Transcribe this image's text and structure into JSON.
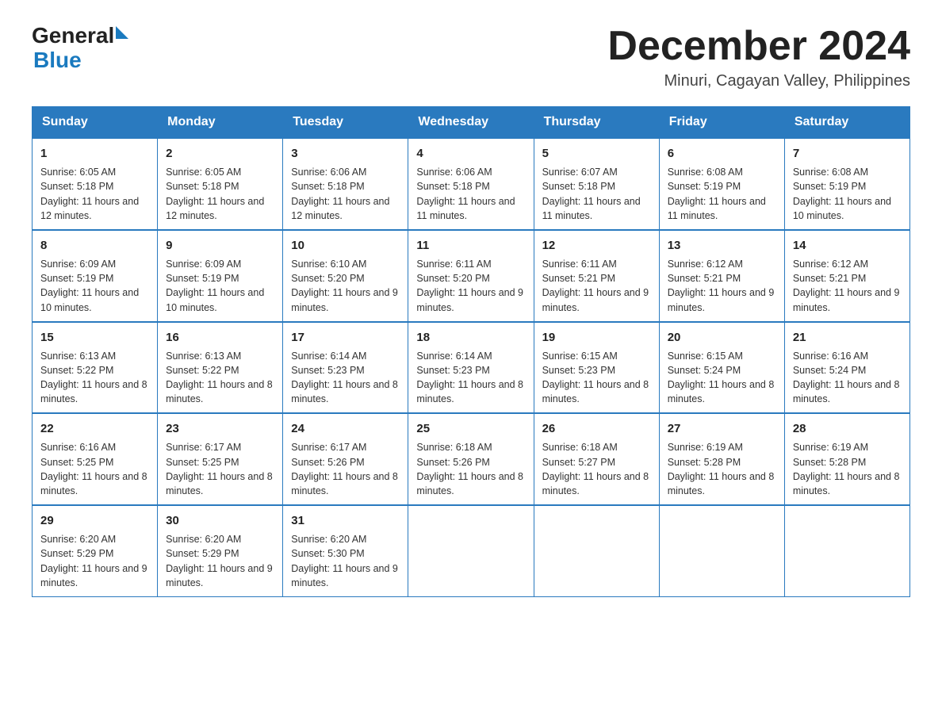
{
  "header": {
    "logo_general": "General",
    "logo_blue": "Blue",
    "month_title": "December 2024",
    "location": "Minuri, Cagayan Valley, Philippines"
  },
  "days_of_week": [
    "Sunday",
    "Monday",
    "Tuesday",
    "Wednesday",
    "Thursday",
    "Friday",
    "Saturday"
  ],
  "weeks": [
    [
      {
        "day": 1,
        "sunrise": "6:05 AM",
        "sunset": "5:18 PM",
        "daylight": "11 hours and 12 minutes."
      },
      {
        "day": 2,
        "sunrise": "6:05 AM",
        "sunset": "5:18 PM",
        "daylight": "11 hours and 12 minutes."
      },
      {
        "day": 3,
        "sunrise": "6:06 AM",
        "sunset": "5:18 PM",
        "daylight": "11 hours and 12 minutes."
      },
      {
        "day": 4,
        "sunrise": "6:06 AM",
        "sunset": "5:18 PM",
        "daylight": "11 hours and 11 minutes."
      },
      {
        "day": 5,
        "sunrise": "6:07 AM",
        "sunset": "5:18 PM",
        "daylight": "11 hours and 11 minutes."
      },
      {
        "day": 6,
        "sunrise": "6:08 AM",
        "sunset": "5:19 PM",
        "daylight": "11 hours and 11 minutes."
      },
      {
        "day": 7,
        "sunrise": "6:08 AM",
        "sunset": "5:19 PM",
        "daylight": "11 hours and 10 minutes."
      }
    ],
    [
      {
        "day": 8,
        "sunrise": "6:09 AM",
        "sunset": "5:19 PM",
        "daylight": "11 hours and 10 minutes."
      },
      {
        "day": 9,
        "sunrise": "6:09 AM",
        "sunset": "5:19 PM",
        "daylight": "11 hours and 10 minutes."
      },
      {
        "day": 10,
        "sunrise": "6:10 AM",
        "sunset": "5:20 PM",
        "daylight": "11 hours and 9 minutes."
      },
      {
        "day": 11,
        "sunrise": "6:11 AM",
        "sunset": "5:20 PM",
        "daylight": "11 hours and 9 minutes."
      },
      {
        "day": 12,
        "sunrise": "6:11 AM",
        "sunset": "5:21 PM",
        "daylight": "11 hours and 9 minutes."
      },
      {
        "day": 13,
        "sunrise": "6:12 AM",
        "sunset": "5:21 PM",
        "daylight": "11 hours and 9 minutes."
      },
      {
        "day": 14,
        "sunrise": "6:12 AM",
        "sunset": "5:21 PM",
        "daylight": "11 hours and 9 minutes."
      }
    ],
    [
      {
        "day": 15,
        "sunrise": "6:13 AM",
        "sunset": "5:22 PM",
        "daylight": "11 hours and 8 minutes."
      },
      {
        "day": 16,
        "sunrise": "6:13 AM",
        "sunset": "5:22 PM",
        "daylight": "11 hours and 8 minutes."
      },
      {
        "day": 17,
        "sunrise": "6:14 AM",
        "sunset": "5:23 PM",
        "daylight": "11 hours and 8 minutes."
      },
      {
        "day": 18,
        "sunrise": "6:14 AM",
        "sunset": "5:23 PM",
        "daylight": "11 hours and 8 minutes."
      },
      {
        "day": 19,
        "sunrise": "6:15 AM",
        "sunset": "5:23 PM",
        "daylight": "11 hours and 8 minutes."
      },
      {
        "day": 20,
        "sunrise": "6:15 AM",
        "sunset": "5:24 PM",
        "daylight": "11 hours and 8 minutes."
      },
      {
        "day": 21,
        "sunrise": "6:16 AM",
        "sunset": "5:24 PM",
        "daylight": "11 hours and 8 minutes."
      }
    ],
    [
      {
        "day": 22,
        "sunrise": "6:16 AM",
        "sunset": "5:25 PM",
        "daylight": "11 hours and 8 minutes."
      },
      {
        "day": 23,
        "sunrise": "6:17 AM",
        "sunset": "5:25 PM",
        "daylight": "11 hours and 8 minutes."
      },
      {
        "day": 24,
        "sunrise": "6:17 AM",
        "sunset": "5:26 PM",
        "daylight": "11 hours and 8 minutes."
      },
      {
        "day": 25,
        "sunrise": "6:18 AM",
        "sunset": "5:26 PM",
        "daylight": "11 hours and 8 minutes."
      },
      {
        "day": 26,
        "sunrise": "6:18 AM",
        "sunset": "5:27 PM",
        "daylight": "11 hours and 8 minutes."
      },
      {
        "day": 27,
        "sunrise": "6:19 AM",
        "sunset": "5:28 PM",
        "daylight": "11 hours and 8 minutes."
      },
      {
        "day": 28,
        "sunrise": "6:19 AM",
        "sunset": "5:28 PM",
        "daylight": "11 hours and 8 minutes."
      }
    ],
    [
      {
        "day": 29,
        "sunrise": "6:20 AM",
        "sunset": "5:29 PM",
        "daylight": "11 hours and 9 minutes."
      },
      {
        "day": 30,
        "sunrise": "6:20 AM",
        "sunset": "5:29 PM",
        "daylight": "11 hours and 9 minutes."
      },
      {
        "day": 31,
        "sunrise": "6:20 AM",
        "sunset": "5:30 PM",
        "daylight": "11 hours and 9 minutes."
      },
      null,
      null,
      null,
      null
    ]
  ]
}
